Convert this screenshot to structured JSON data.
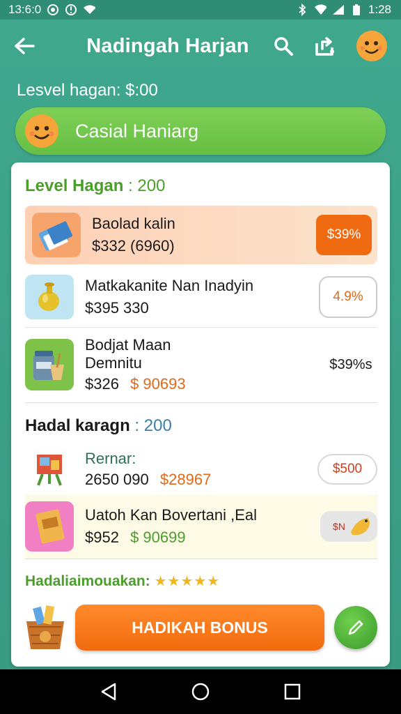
{
  "status_bar": {
    "time_left": "13:6:0",
    "time_right": "1:28"
  },
  "header": {
    "title": "Nadingah Harjan"
  },
  "level_line": "Lesvel hagan: $:00",
  "banner": {
    "text": "Casial Haniarg"
  },
  "section1": {
    "title": "Level Hagan",
    "value": ": 200",
    "items": [
      {
        "name": "Baolad kalin",
        "name2": "",
        "price": "$332 (6960)",
        "alt_price": "",
        "badge": "$39%"
      },
      {
        "name": "Matkakanite Nan Inadyin",
        "name2": "",
        "price": "$395 330",
        "alt_price": "",
        "badge": "4.9%"
      },
      {
        "name": "Bodjat Maan",
        "name2": "Demnitu",
        "price": "$326",
        "alt_price": "$ 90693",
        "badge": "$39%s"
      }
    ]
  },
  "section2": {
    "title": "Hadal karagn",
    "value": ": 200",
    "items": [
      {
        "name": "Rernar:",
        "price": "2650 090",
        "alt_price": "$28967",
        "badge": "$500"
      },
      {
        "name": "Uatoh Kan Bovertani ,Eal",
        "price": "$952",
        "alt_price": "$ 90699",
        "badge": "$N"
      }
    ]
  },
  "rating": {
    "label": "Hadaliaimouakan:",
    "stars": "★★★★★"
  },
  "cta": {
    "label": "HADIKAH BONUS"
  },
  "colors": {
    "accent_orange": "#f26b0f",
    "accent_green": "#67bf43",
    "bg_teal": "#3fa88d"
  }
}
